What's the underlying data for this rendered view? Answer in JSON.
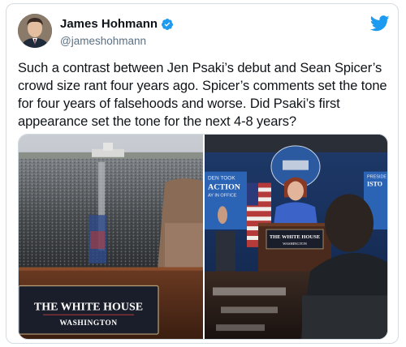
{
  "author": {
    "display_name": "James Hohmann",
    "handle": "@jameshohmann",
    "verified": true
  },
  "tweet": {
    "text": "Such a contrast between Jen Psaki’s debut and Sean Spicer’s crowd size rant four years ago. Spicer’s comments set the tone for four years of falsehoods and worse. Did Psaki’s first appearance set the tone for the next 4-8 years?"
  },
  "media": {
    "left_sign_line1": "THE WHITE HOUSE",
    "left_sign_line2": "WASHINGTON",
    "right_sign_line1": "THE WHITE HOUSE",
    "right_sign_line2": "WASHINGTON",
    "right_banner_line1": "DEN TOOK",
    "right_banner_line2": "ACTION",
    "right_banner_line3": "AY IN OFFICE",
    "right_banner_right": "PRESIDE",
    "right_banner_right2": "ISTO"
  },
  "icons": {
    "verified": "verified-badge-icon",
    "twitter": "twitter-bird-icon"
  },
  "colors": {
    "brand_blue": "#1d9bf0",
    "text_primary": "#0f1419",
    "text_secondary": "#5b7083",
    "border": "#d4dbe1"
  }
}
